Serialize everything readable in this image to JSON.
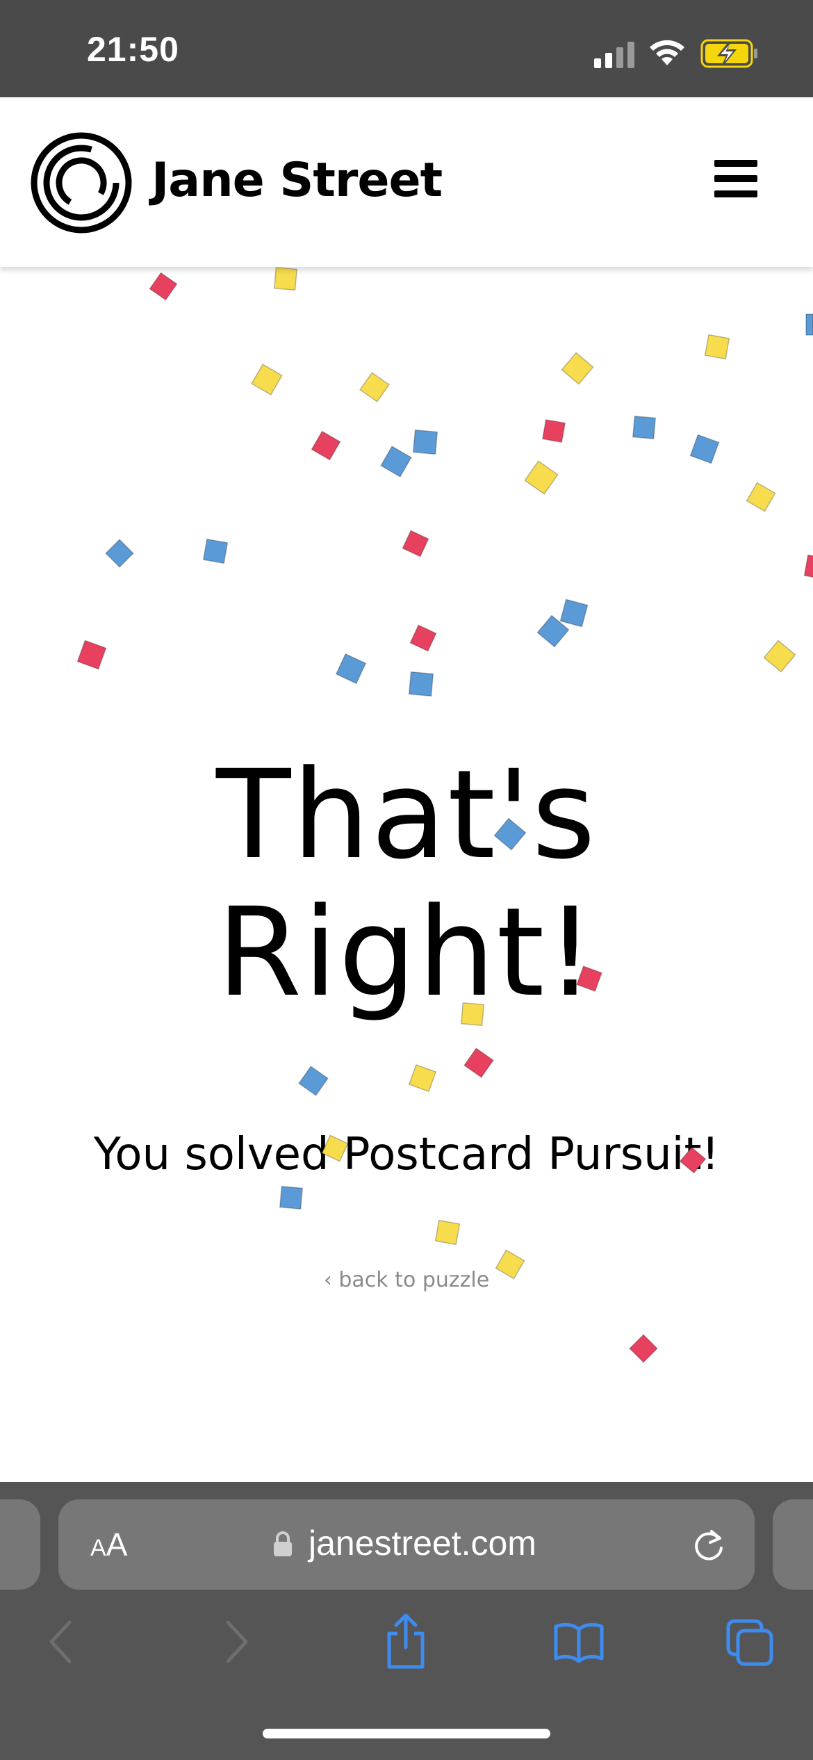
{
  "status_bar": {
    "time": "21:50",
    "icons": [
      "cellular-signal-icon",
      "wifi-icon",
      "battery-charging-icon"
    ],
    "battery_color": "#f5d50b"
  },
  "header": {
    "logo_icon": "jane-street-logo-icon",
    "brand_name": "Jane Street",
    "menu_icon": "hamburger-menu-icon"
  },
  "main": {
    "headline_line1": "That's",
    "headline_line2": "Right!",
    "message": "You solved Postcard Pursuit!",
    "back_link": "‹ back to puzzle",
    "confetti_colors": {
      "red": "#e8415f",
      "yellow": "#f7dc4e",
      "blue": "#5a9ad6"
    }
  },
  "browser": {
    "text_size_small": "A",
    "text_size_big": "A",
    "url": "janestreet.com",
    "toolbar_icons": [
      "back-arrow-icon",
      "forward-arrow-icon",
      "share-icon",
      "bookmarks-icon",
      "tabs-icon"
    ],
    "accent_color": "#3d8cf0"
  }
}
